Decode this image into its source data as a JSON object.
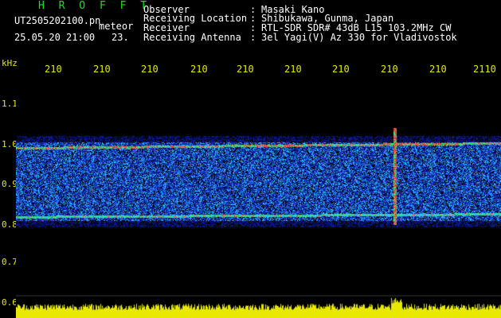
{
  "header": {
    "brand": "H R O F F T",
    "filename": "UT2505202100.pn",
    "meteor": "meteor",
    "datetime": "25.05.20 21:00",
    "count": "23."
  },
  "meta": [
    {
      "label": "Observer",
      "value": "Masaki Kano"
    },
    {
      "label": "Receiving Location",
      "value": "Shibukawa, Gunma, Japan"
    },
    {
      "label": "Receiver",
      "value": "RTL-SDR SDR# 43dB L15 103.2MHz CW"
    },
    {
      "label": "Receiving Antenna",
      "value": "3el Yagi(V) Az 330 for Vladivostok"
    }
  ],
  "colon": ":",
  "chart_data": {
    "type": "heatmap",
    "y_unit": "kHz",
    "x_ticks": [
      "210",
      "210",
      "210",
      "210",
      "210",
      "210",
      "210",
      "210",
      "210",
      "2110"
    ],
    "y_ticks": [
      "1.1",
      "1.0",
      "0.9",
      "0.8",
      "0.7",
      "0.6"
    ],
    "ylim": [
      0.6,
      1.15
    ],
    "carriers_khz": [
      0.99,
      0.82
    ],
    "colors": {
      "low": "#0a1aa0",
      "mid": "#22c8ff",
      "high": "#ff2020",
      "text": "#e8e800",
      "brand": "#1fdf1f"
    }
  }
}
